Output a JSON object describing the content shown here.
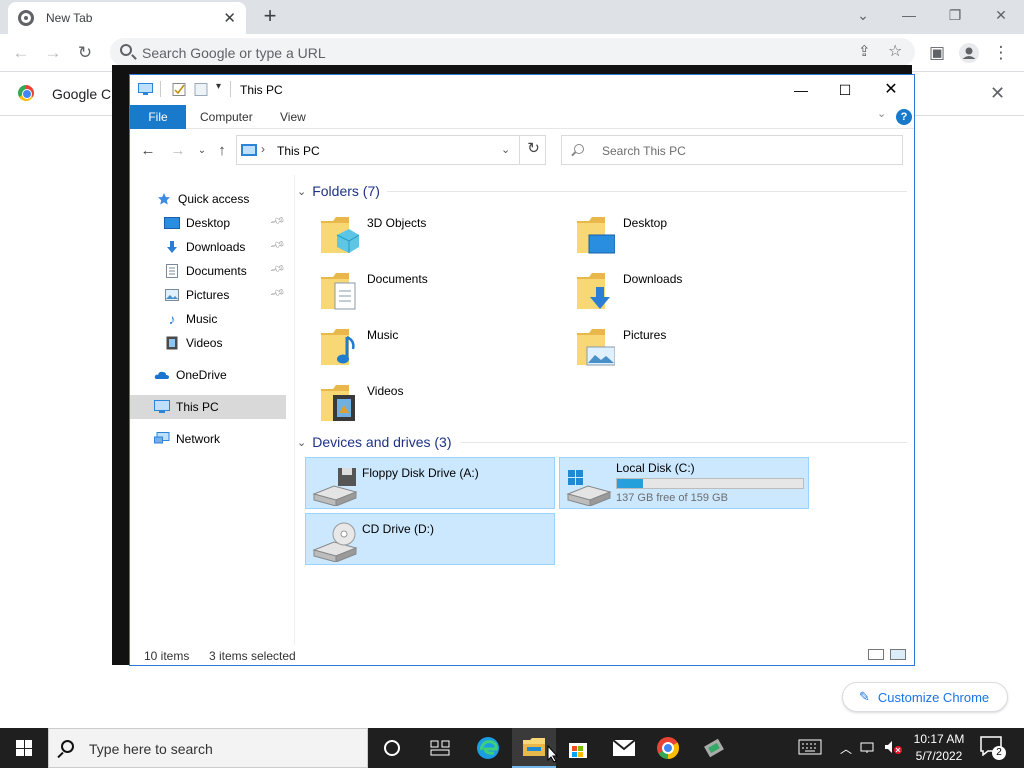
{
  "chrome": {
    "tab_title": "New Tab",
    "omnibox_placeholder": "Search Google or type a URL",
    "bookmark_label": "Google Ch",
    "customize_label": "Customize Chrome"
  },
  "explorer": {
    "window_title": "This PC",
    "ribbon_tabs": [
      "File",
      "Computer",
      "View"
    ],
    "address_crumb": "This PC",
    "search_placeholder": "Search This PC",
    "sidebar": {
      "quick_access": "Quick access",
      "quick_items": [
        {
          "label": "Desktop",
          "icon": "desktop-icon",
          "pinned": true
        },
        {
          "label": "Downloads",
          "icon": "downloads-icon",
          "pinned": true
        },
        {
          "label": "Documents",
          "icon": "documents-icon",
          "pinned": true
        },
        {
          "label": "Pictures",
          "icon": "pictures-icon",
          "pinned": true
        },
        {
          "label": "Music",
          "icon": "music-icon",
          "pinned": false
        },
        {
          "label": "Videos",
          "icon": "videos-icon",
          "pinned": false
        }
      ],
      "onedrive": "OneDrive",
      "this_pc": "This PC",
      "network": "Network"
    },
    "folders_header": "Folders (7)",
    "folders": [
      "3D Objects",
      "Desktop",
      "Documents",
      "Downloads",
      "Music",
      "Pictures",
      "Videos"
    ],
    "drives_header": "Devices and drives (3)",
    "drives": [
      {
        "name": "Floppy Disk Drive (A:)",
        "icon": "floppy-drive-icon"
      },
      {
        "name": "Local Disk (C:)",
        "icon": "local-disk-icon",
        "free_text": "137 GB free of 159 GB",
        "used_fraction": 0.14
      },
      {
        "name": "CD Drive (D:)",
        "icon": "cd-drive-icon"
      }
    ],
    "status_items": "10 items",
    "status_selected": "3 items selected"
  },
  "taskbar": {
    "search_placeholder": "Type here to search",
    "time": "10:17 AM",
    "date": "5/7/2022",
    "notification_count": "2"
  },
  "colors": {
    "accent_blue": "#1979ca",
    "selection_blue": "#cce8ff",
    "folder_yellow": "#f8d775",
    "drive_bar": "#26a0da"
  }
}
